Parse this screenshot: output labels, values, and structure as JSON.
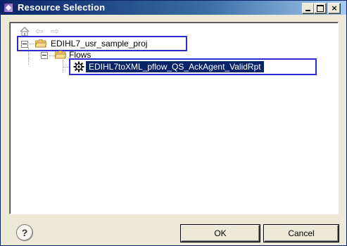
{
  "window": {
    "title": "Resource Selection",
    "controls": {
      "minimize_icon": "minimize-icon",
      "maximize_icon": "maximize-icon",
      "close_glyph": "×"
    }
  },
  "toolbar": {
    "home_icon": "home-icon",
    "back_glyph": "⇦",
    "forward_glyph": "⇨"
  },
  "tree": {
    "root": {
      "label": "EDIHL7_usr_sample_proj",
      "expanded": true,
      "icon": "open-folder-icon"
    },
    "folder": {
      "label": "Flows",
      "expanded": true,
      "icon": "open-folder-icon"
    },
    "item": {
      "label": "EDIHL7toXML_pflow_QS_AckAgent_ValidRpt",
      "selected": true,
      "icon": "gear-icon"
    }
  },
  "footer": {
    "help_glyph": "?",
    "ok_label": "OK",
    "cancel_label": "Cancel"
  },
  "colors": {
    "title_gradient_start": "#0a246a",
    "title_gradient_end": "#a6caf0",
    "selection_bg": "#0a246a",
    "highlight_box": "#2b2bcf",
    "dialog_bg": "#ece9d8"
  }
}
